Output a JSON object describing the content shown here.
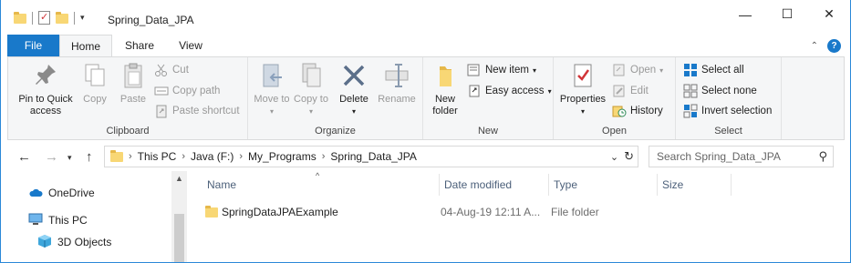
{
  "window": {
    "title": "Spring_Data_JPA",
    "controls": {
      "minimize": "—",
      "maximize": "☐",
      "close": "✕"
    }
  },
  "ribbon_tabs": {
    "file": "File",
    "home": "Home",
    "share": "Share",
    "view": "View"
  },
  "clipboard": {
    "pin": "Pin to Quick access",
    "copy": "Copy",
    "paste": "Paste",
    "cut": "Cut",
    "copy_path": "Copy path",
    "paste_shortcut": "Paste shortcut",
    "label": "Clipboard"
  },
  "organize": {
    "move_to": "Move to",
    "copy_to": "Copy to",
    "delete": "Delete",
    "rename": "Rename",
    "label": "Organize"
  },
  "new_group": {
    "new_folder": "New folder",
    "new_item": "New item",
    "easy_access": "Easy access",
    "label": "New"
  },
  "open_group": {
    "properties": "Properties",
    "open": "Open",
    "edit": "Edit",
    "history": "History",
    "label": "Open"
  },
  "select_group": {
    "select_all": "Select all",
    "select_none": "Select none",
    "invert_selection": "Invert selection",
    "label": "Select"
  },
  "address": {
    "crumbs": [
      "This PC",
      "Java (F:)",
      "My_Programs",
      "Spring_Data_JPA"
    ]
  },
  "search": {
    "placeholder": "Search Spring_Data_JPA"
  },
  "nav_pane": {
    "items": [
      "OneDrive",
      "This PC",
      "3D Objects"
    ]
  },
  "columns": {
    "name": "Name",
    "date_modified": "Date modified",
    "type": "Type",
    "size": "Size"
  },
  "files": [
    {
      "name": "SpringDataJPAExample",
      "date_modified": "04-Aug-19 12:11 A...",
      "type": "File folder",
      "size": ""
    }
  ],
  "colors": {
    "accent": "#1979ca",
    "folder": "#f8d775",
    "ribbon_bg": "#f5f6f7",
    "window_border": "#2b88d8"
  }
}
